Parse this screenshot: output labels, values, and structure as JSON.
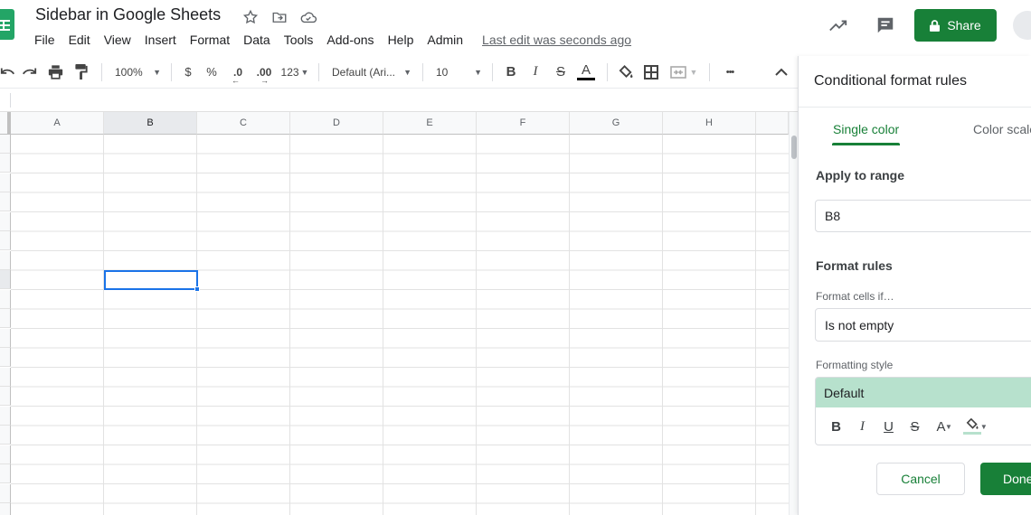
{
  "header": {
    "doc_title": "Sidebar in Google Sheets",
    "menu": [
      "File",
      "Edit",
      "View",
      "Insert",
      "Format",
      "Data",
      "Tools",
      "Add-ons",
      "Help",
      "Admin"
    ],
    "last_edit": "Last edit was seconds ago",
    "share_label": "Share"
  },
  "toolbar": {
    "zoom": "100%",
    "currency": "$",
    "percent": "%",
    "decimal_decrease": ".0",
    "decimal_increase": ".00",
    "more_formats": "123",
    "font": "Default (Ari...",
    "font_size": "10",
    "bold": "B",
    "italic": "I",
    "strike": "S",
    "text_color": "A",
    "more": "•••"
  },
  "grid": {
    "columns": [
      "A",
      "B",
      "C",
      "D",
      "E",
      "F",
      "G",
      "H"
    ],
    "selected_column": "B",
    "active_cell": "B8"
  },
  "sidebar": {
    "title": "Conditional format rules",
    "tabs": [
      "Single color",
      "Color scale"
    ],
    "apply_range_label": "Apply to range",
    "range_value": "B8",
    "format_rules_label": "Format rules",
    "format_cells_if_label": "Format cells if…",
    "condition_value": "Is not empty",
    "formatting_style_label": "Formatting style",
    "style_value": "Default",
    "style_tools": {
      "bold": "B",
      "italic": "I",
      "underline": "U",
      "strike": "S",
      "text_color": "A"
    },
    "cancel_label": "Cancel",
    "done_label": "Done"
  },
  "colors": {
    "brand_green": "#188038",
    "selection_blue": "#1a73e8",
    "style_preview_bg": "#b7e1cd"
  }
}
